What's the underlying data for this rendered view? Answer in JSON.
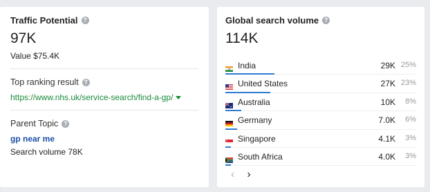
{
  "traffic": {
    "title": "Traffic Potential",
    "value": "97K",
    "value_line": "Value $75.4K"
  },
  "top_ranking": {
    "label": "Top ranking result",
    "url": "https://www.nhs.uk/service-search/find-a-gp/"
  },
  "parent_topic": {
    "label": "Parent Topic",
    "topic": "gp near me",
    "search_volume": "Search volume 78K"
  },
  "global": {
    "title": "Global search volume",
    "value": "114K",
    "countries": [
      {
        "name": "India",
        "volume": "29K",
        "percent": "25%",
        "share": 0.25
      },
      {
        "name": "United States",
        "volume": "27K",
        "percent": "23%",
        "share": 0.23
      },
      {
        "name": "Australia",
        "volume": "10K",
        "percent": "8%",
        "share": 0.08
      },
      {
        "name": "Germany",
        "volume": "7.0K",
        "percent": "6%",
        "share": 0.06
      },
      {
        "name": "Singapore",
        "volume": "4.1K",
        "percent": "3%",
        "share": 0.03
      },
      {
        "name": "South Africa",
        "volume": "4.0K",
        "percent": "3%",
        "share": 0.03
      }
    ],
    "pager": {
      "prev": "‹",
      "next": "›"
    }
  },
  "icons": {
    "help": "?",
    "dropdown": "caret-down-icon"
  },
  "colors": {
    "accent_bar": "#2d7bd4",
    "link_green": "#1a8a3a",
    "topic_blue": "#1a4fa8"
  }
}
